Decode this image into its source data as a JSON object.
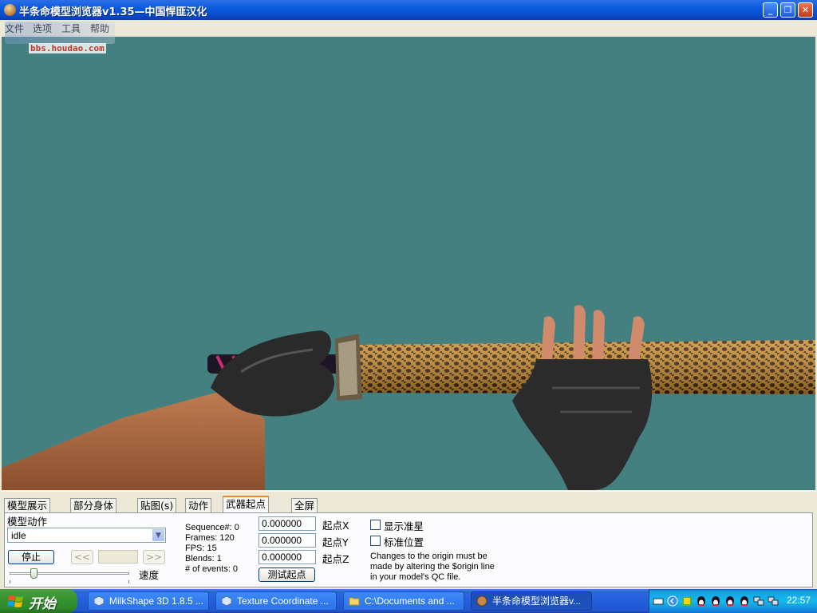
{
  "window": {
    "title": "半条命模型浏览器v1.35—中国悍匪汉化",
    "menu": [
      "文件",
      "选项",
      "工具",
      "帮助"
    ],
    "watermark_url": "bbs.houdao.com"
  },
  "tabs": [
    "模型展示",
    "部分身体",
    "贴图(s)",
    "动作",
    "武器起点",
    "全屏"
  ],
  "active_tab": "武器起点",
  "panel": {
    "sequence_label": "模型动作",
    "sequence_value": "idle",
    "stop_button": "停止",
    "prev_button": "<<",
    "next_button": ">>",
    "speed_label": "速度",
    "info": {
      "sequence": "Sequence#: 0",
      "frames": "Frames: 120",
      "fps": "FPS: 15",
      "blends": "Blends: 1",
      "events": "# of events: 0"
    },
    "origin_x": "0.000000",
    "origin_y": "0.000000",
    "origin_z": "0.000000",
    "label_x": "起点X",
    "label_y": "起点Y",
    "label_z": "起点Z",
    "test_button": "测试起点",
    "show_crosshair": "显示准星",
    "standard_position": "标准位置",
    "note_line1": "Changes to the origin must be",
    "note_line2": "made by altering the $origin line",
    "note_line3": "in your model's QC file."
  },
  "taskbar": {
    "start": "开始",
    "tasks": [
      "MilkShape 3D 1.8.5 ...",
      "Texture Coordinate ...",
      "C:\\Documents and ...",
      "半条命模型浏览器v..."
    ],
    "clock": "22:57"
  },
  "colors": {
    "viewport_bg": "#458080",
    "titlebar": "#0a5be0",
    "active_tab_accent": "#e68b2c"
  }
}
